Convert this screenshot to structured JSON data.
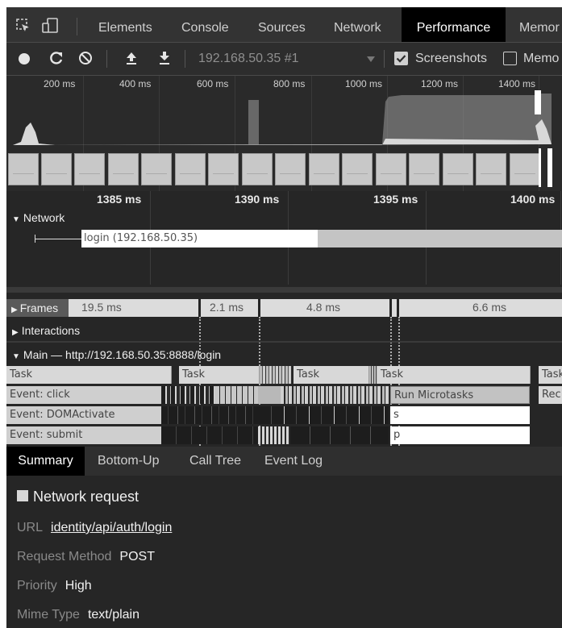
{
  "tabs": {
    "elements": "Elements",
    "console": "Console",
    "sources": "Sources",
    "network": "Network",
    "performance": "Performance",
    "memory": "Memor"
  },
  "toolbar": {
    "recording_select": "192.168.50.35 #1",
    "screenshots_label": "Screenshots",
    "screenshots_checked": true,
    "memory_label": "Memo",
    "memory_checked": false
  },
  "overview": {
    "ticks": [
      "200 ms",
      "400 ms",
      "600 ms",
      "800 ms",
      "1000 ms",
      "1200 ms",
      "1400 ms"
    ]
  },
  "ruler": {
    "labels": [
      "1385 ms",
      "1390 ms",
      "1395 ms",
      "1400 ms"
    ]
  },
  "network_track": {
    "title": "Network",
    "request_label": "login (192.168.50.35)"
  },
  "frames": {
    "title": "Frames",
    "durations": [
      "19.5 ms",
      "2.1 ms",
      "4.8 ms",
      "6.6 ms"
    ]
  },
  "interactions": {
    "title": "Interactions"
  },
  "main_thread": {
    "title": "Main — http://192.168.50.35:8888/login",
    "rows": {
      "task": "Task",
      "click": "Event: click",
      "domactivate": "Event: DOMActivate",
      "submit": "Event: submit",
      "run_microtasks": "Run Microtasks",
      "rec": "Rec",
      "s": "s",
      "p": "p"
    }
  },
  "bottom_tabs": [
    "Summary",
    "Bottom-Up",
    "Call Tree",
    "Event Log"
  ],
  "summary": {
    "heading": "Network request",
    "url_key": "URL",
    "url_value": "identity/api/auth/login",
    "method_key": "Request Method",
    "method_value": "POST",
    "priority_key": "Priority",
    "priority_value": "High",
    "mime_key": "Mime Type",
    "mime_value": "text/plain"
  },
  "colors": {
    "panel": "#262626",
    "active_tab": "#000000",
    "flame_light": "#d2d2d2",
    "network_bar": "#ffffff"
  }
}
